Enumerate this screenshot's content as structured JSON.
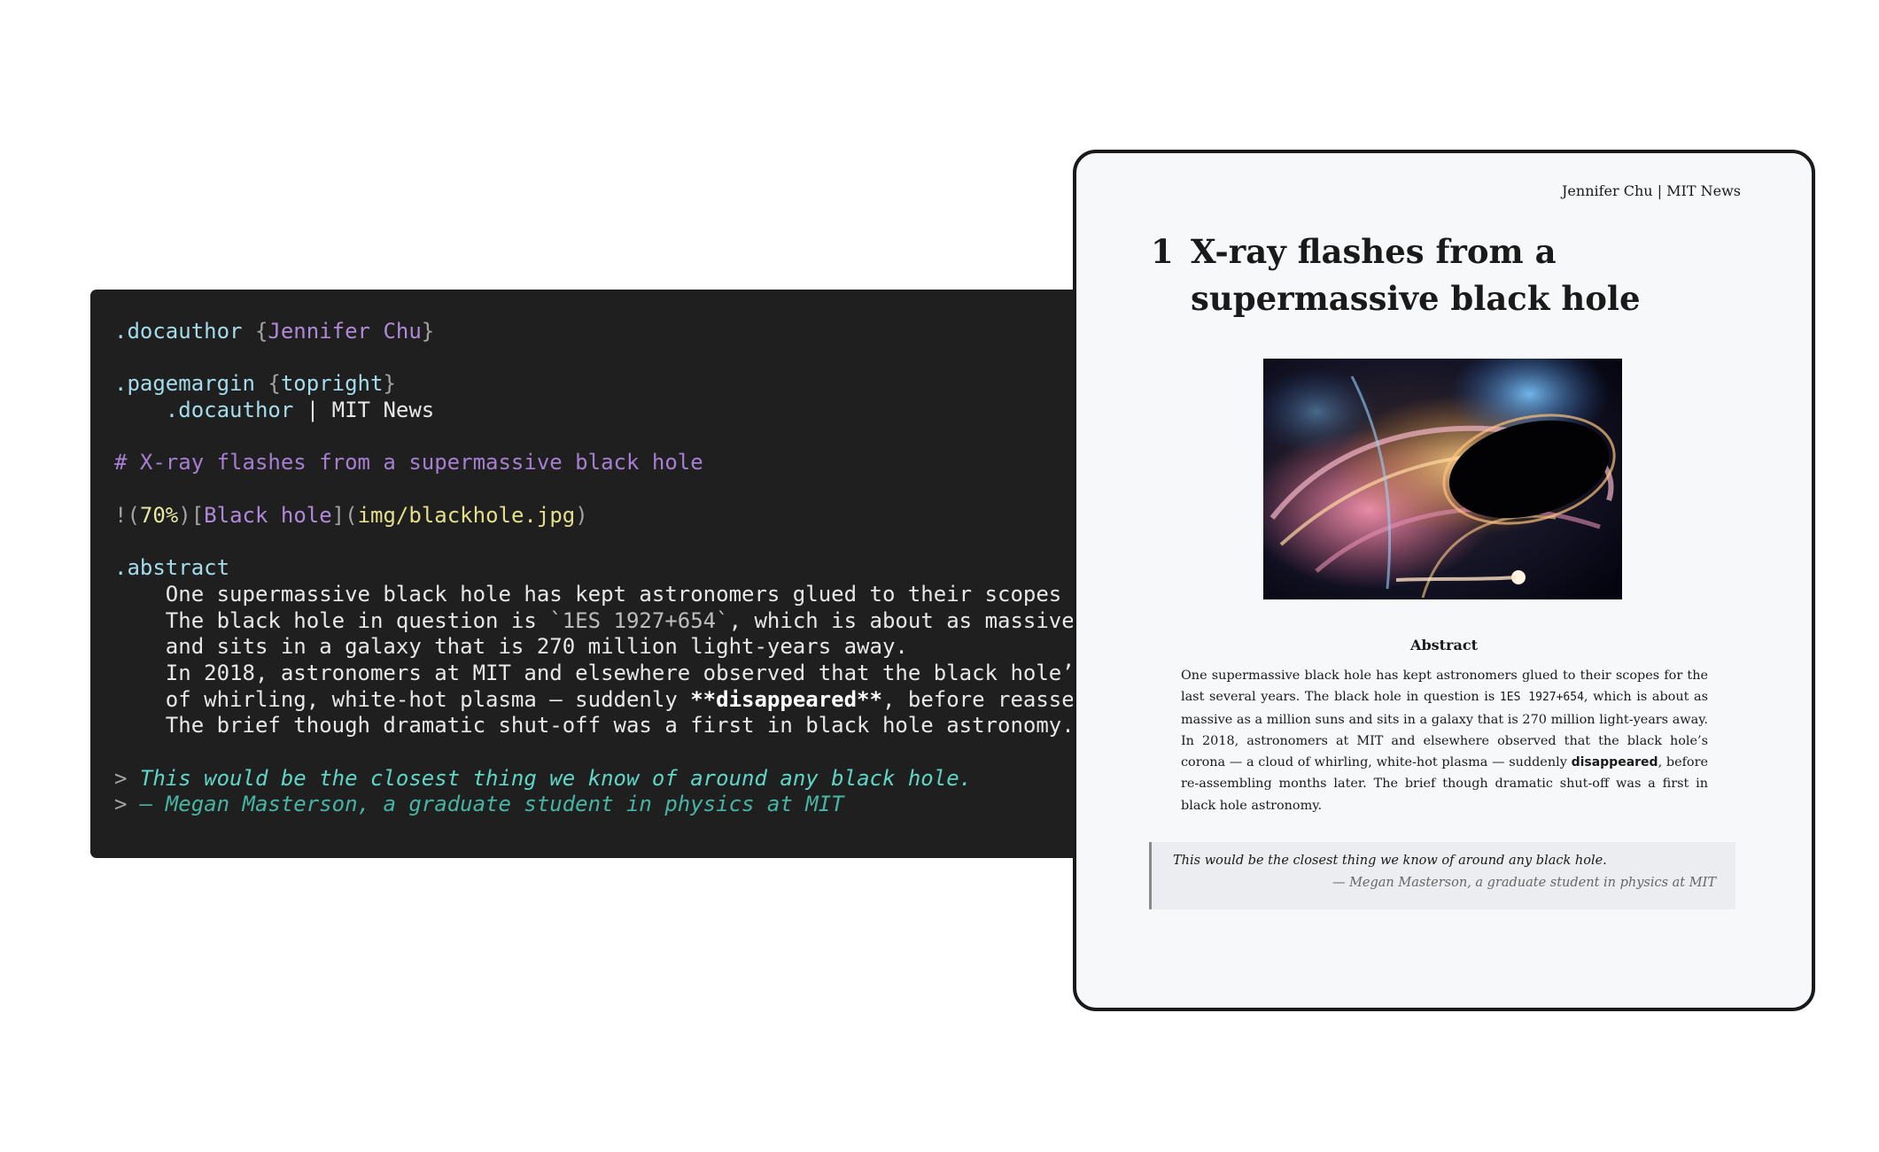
{
  "editor": {
    "lines": {
      "l1": {
        "cls": ".docauthor",
        "open": " {",
        "val": "Jennifer Chu",
        "close": "}"
      },
      "l2": {
        "cls": ".pagemargin",
        "open": " {",
        "val": "topright",
        "close": "}"
      },
      "l3": {
        "cls": "    .docauthor",
        "rest": " | MIT News"
      },
      "l4": {
        "head": "# X-ray flashes from a supermassive black hole"
      },
      "l5": {
        "bang": "!(",
        "num": "70%",
        "mid": ")[",
        "alt": "Black hole",
        "mid2": "](",
        "path": "img/blackhole.jpg",
        "end": ")"
      },
      "l6": {
        "cls": ".abstract"
      },
      "l7": {
        "text": "    One supermassive black hole has kept astronomers glued to their scopes for"
      },
      "l8": {
        "pre": "    The black hole in question is ",
        "code": "`1ES 1927+654`",
        "post": ", which is about as massive as"
      },
      "l9": {
        "text": "    and sits in a galaxy that is 270 million light-years away."
      },
      "l10": {
        "text": "    In 2018, astronomers at MIT and elsewhere observed that the black hole’s c"
      },
      "l11": {
        "pre": "    of whirling, white-hot plasma — suddenly ",
        "bold": "**disappeared**",
        "post": ", before reassem"
      },
      "l12": {
        "text": "    The brief though dramatic shut-off was a first in black hole astronomy."
      },
      "l13": {
        "mark": "> ",
        "text": "This would be the closest thing we know of around any black hole."
      },
      "l14": {
        "mark": "> ",
        "text": "– Megan Masterson, a graduate student in physics at MIT"
      }
    }
  },
  "preview": {
    "running_head": "Jennifer Chu | MIT News",
    "section_number": "1",
    "title": "X-ray flashes from a supermassive black hole",
    "figure_alt": "Black hole",
    "abstract_heading": "Abstract",
    "abstract": {
      "p1": "One supermassive black hole has kept astronomers glued to their scopes for the last several years. The black hole in question is ",
      "code": "1ES 1927+654",
      "p2": ", which is about as massive as a million suns and sits in a galaxy that is 270 million light-years away. In 2018, astronomers at MIT and elsewhere observed that the black hole’s corona — a cloud of whirling, white-hot plasma — suddenly ",
      "bold": "disappeared",
      "p3": ", before re-assembling months later. The brief though dramatic shut-off was a first in black hole astronomy."
    },
    "quote": {
      "text": "This would be the closest thing we know of around any black hole.",
      "attribution": "— Megan Masterson, a graduate student in physics at MIT"
    }
  }
}
